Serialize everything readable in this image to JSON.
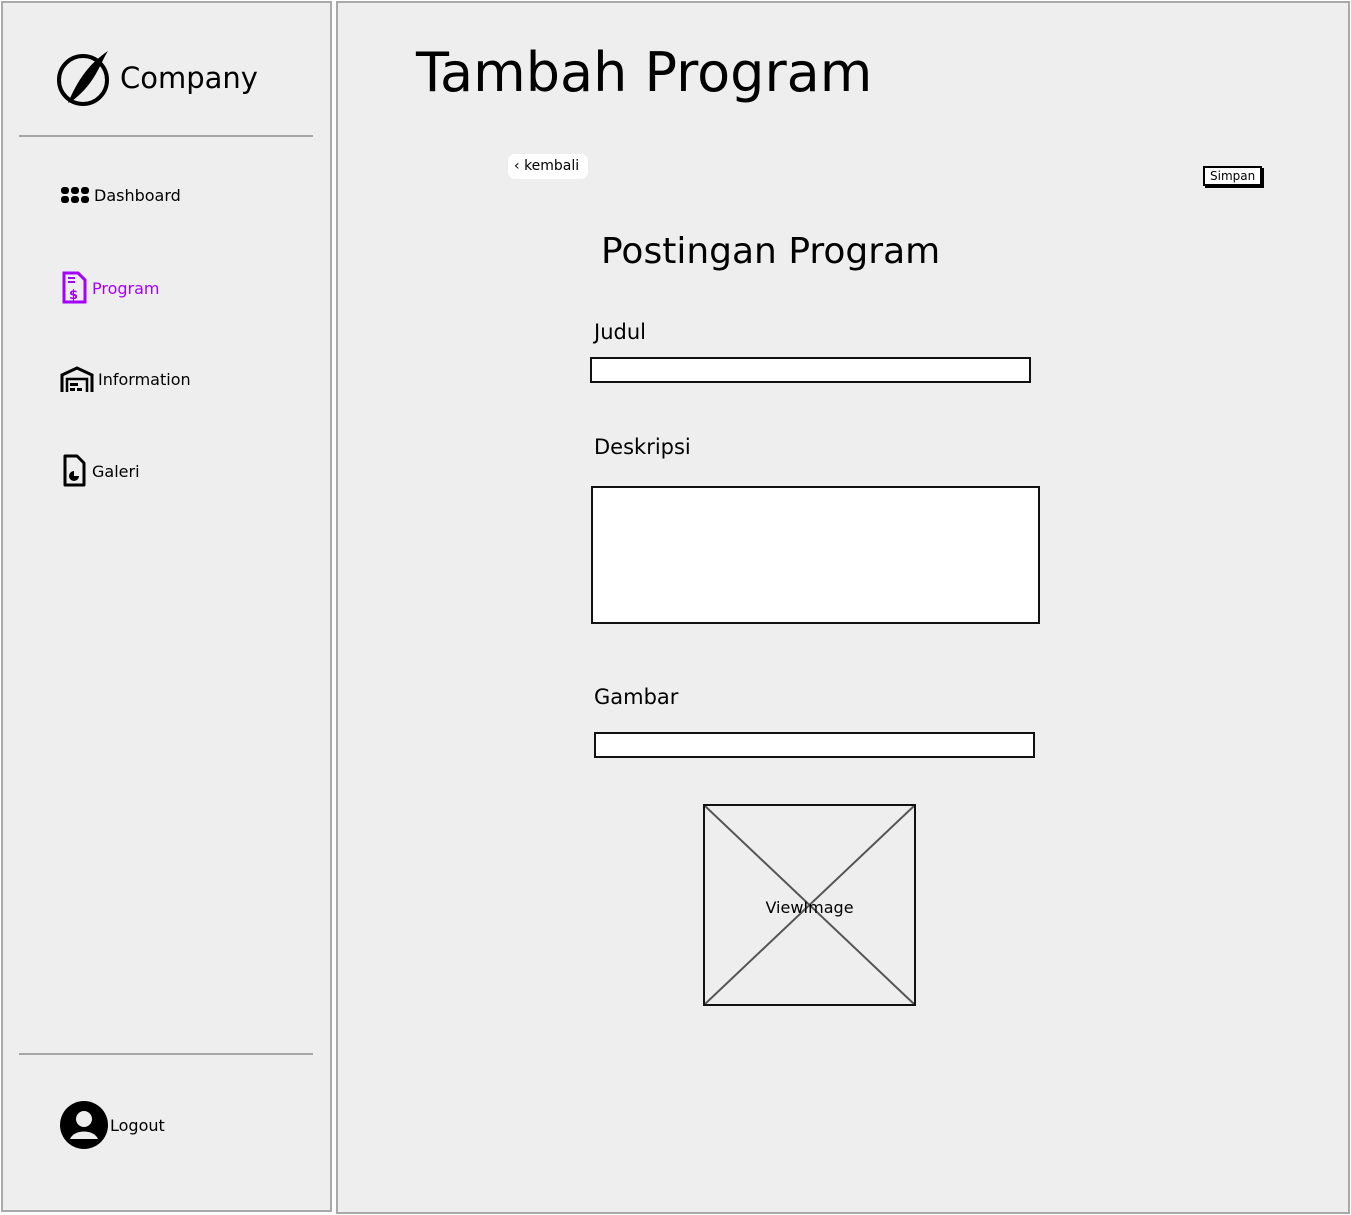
{
  "brand": {
    "name": "Company"
  },
  "sidebar": {
    "items": [
      {
        "label": "Dashboard",
        "icon": "grid-icon"
      },
      {
        "label": "Program",
        "icon": "invoice-icon",
        "active": true
      },
      {
        "label": "Information",
        "icon": "warehouse-icon"
      },
      {
        "label": "Galeri",
        "icon": "file-chart-icon"
      }
    ],
    "logout": "Logout"
  },
  "colors": {
    "accent": "#a300ff"
  },
  "header": {
    "title": "Tambah Program"
  },
  "toolbar": {
    "back": "kembali",
    "save": "Simpan"
  },
  "form": {
    "title": "Postingan Program",
    "judul_label": "Judul",
    "judul_value": "",
    "deskripsi_label": "Deskripsi",
    "deskripsi_value": "",
    "gambar_label": "Gambar",
    "gambar_value": "",
    "image_placeholder": "ViewImage"
  }
}
